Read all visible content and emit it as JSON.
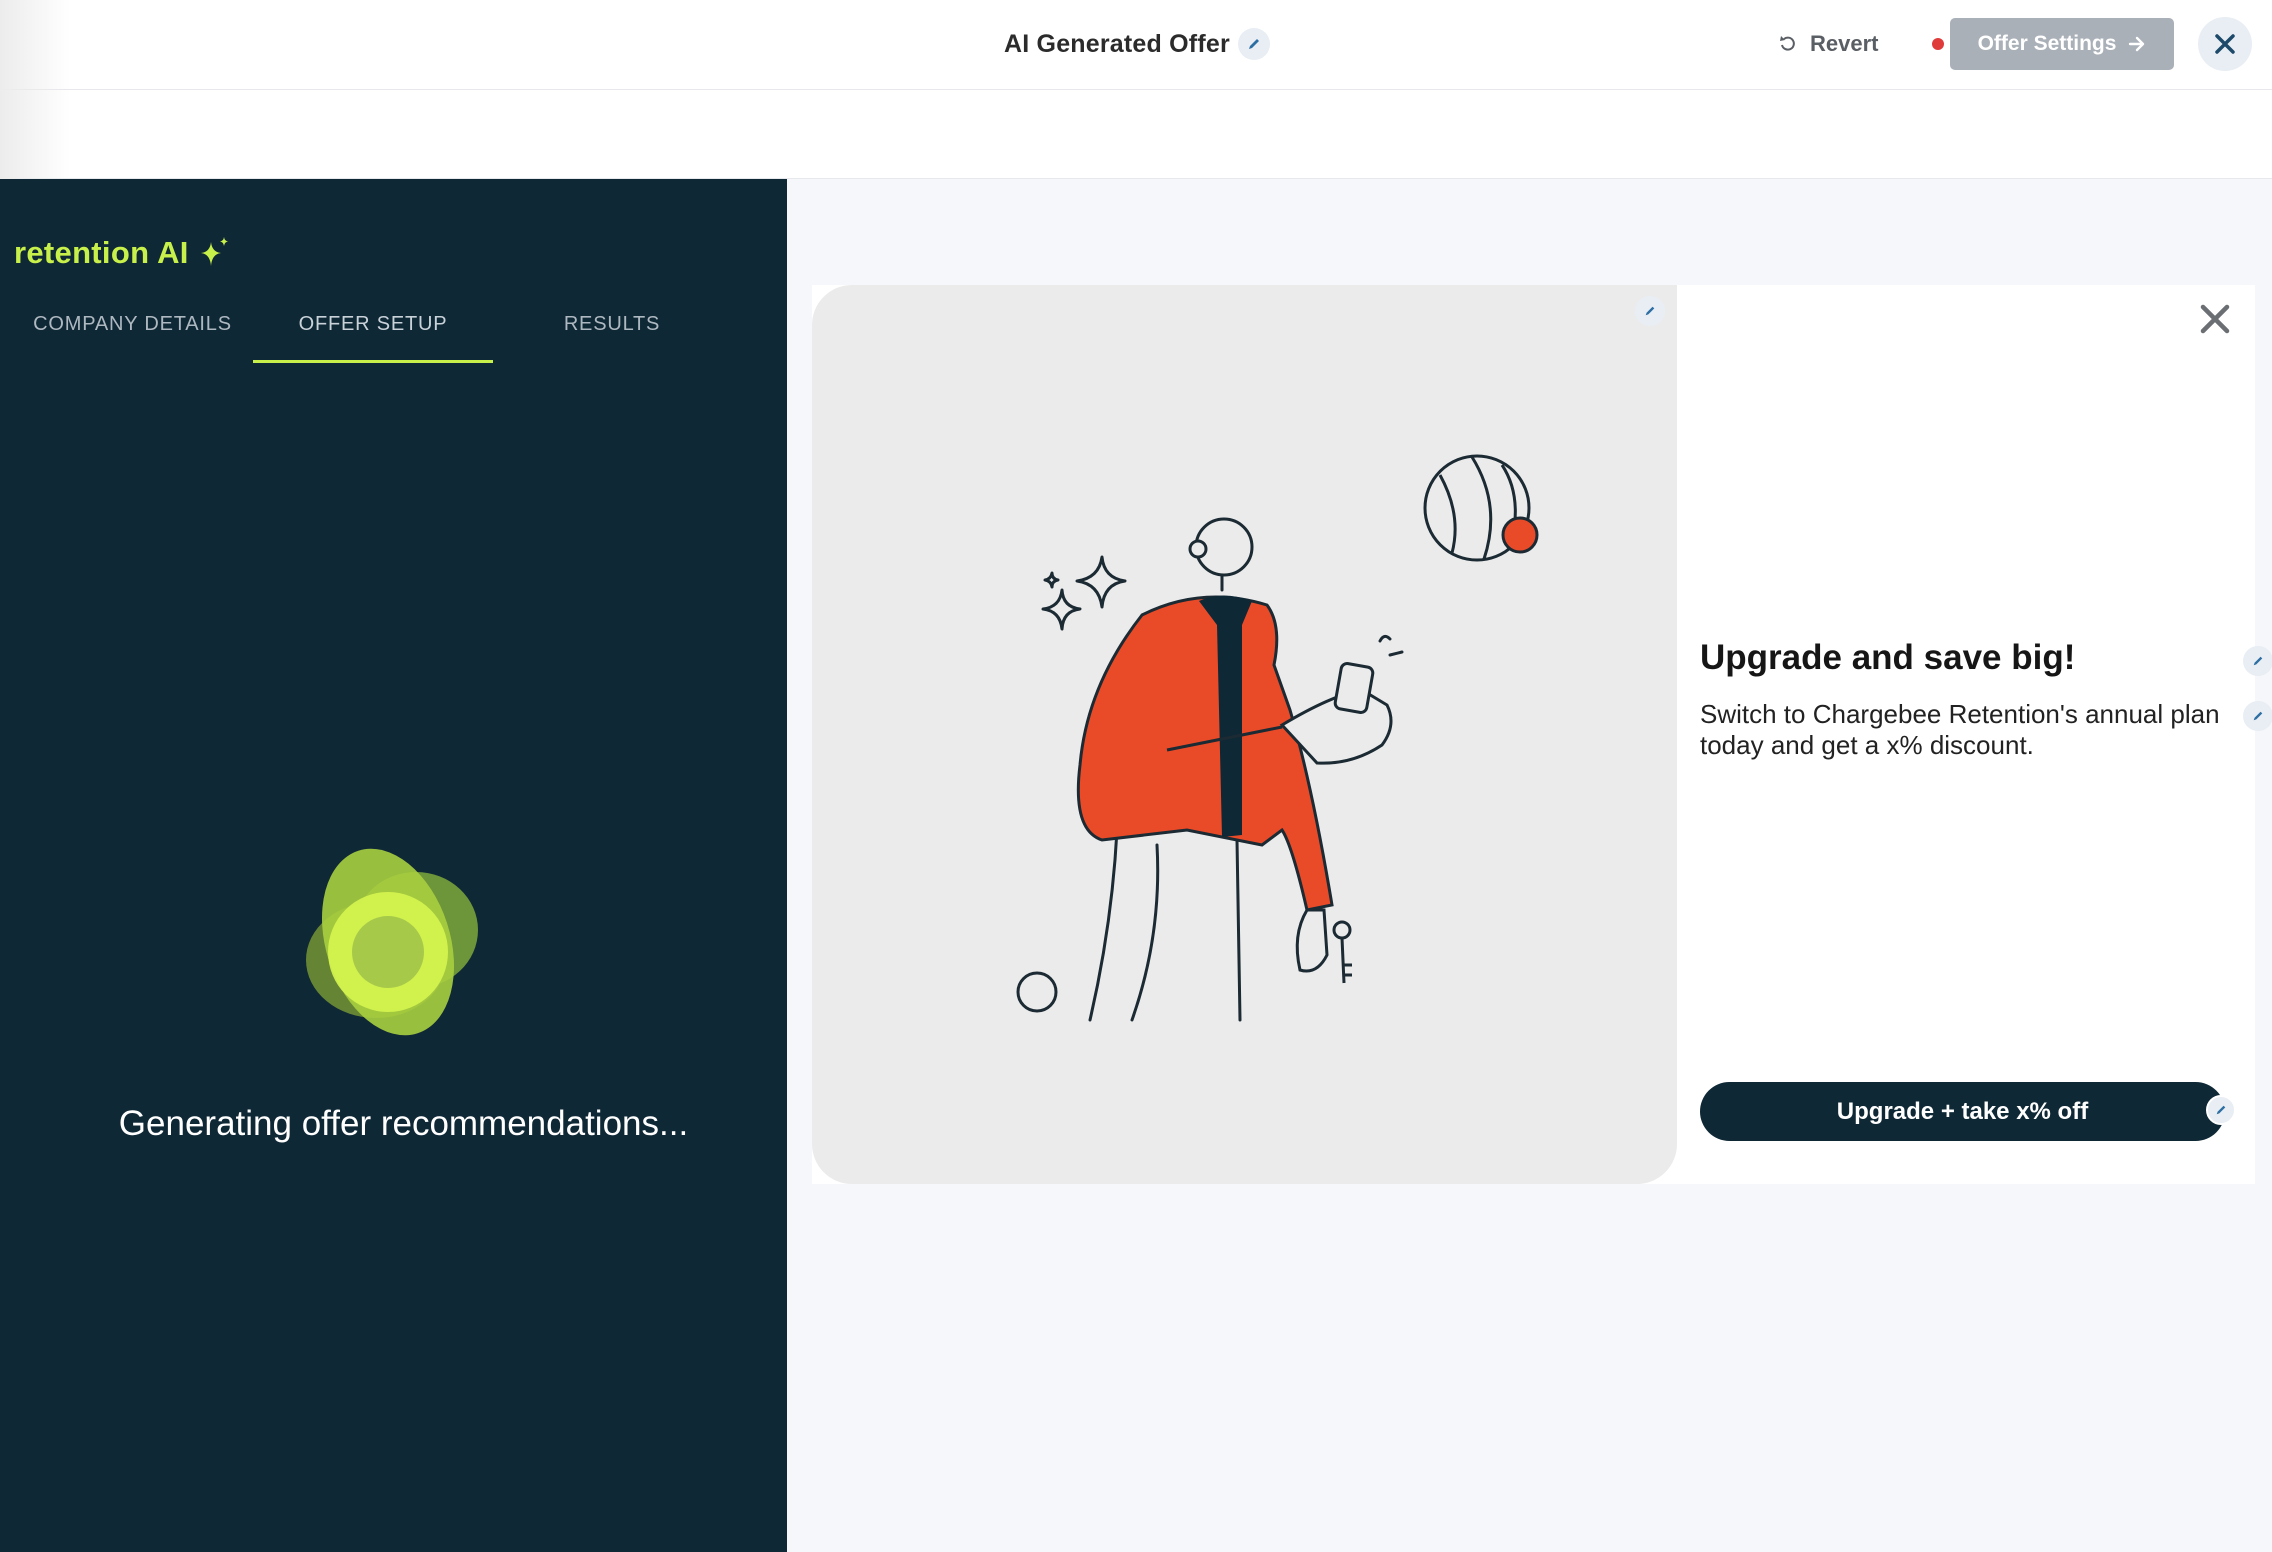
{
  "header": {
    "title": "AI Generated Offer",
    "revert_label": "Revert",
    "offer_settings_label": "Offer Settings"
  },
  "sidebar": {
    "brand": "retention AI",
    "tabs": [
      {
        "label": "COMPANY DETAILS",
        "active": false
      },
      {
        "label": "OFFER SETUP",
        "active": true
      },
      {
        "label": "RESULTS",
        "active": false
      }
    ],
    "status_text": "Generating offer recommendations..."
  },
  "offer": {
    "headline": "Upgrade and save big!",
    "description": "Switch to Chargebee Retention's annual plan today and get a x% discount.",
    "cta_label": "Upgrade + take x% off"
  },
  "colors": {
    "navy": "#0f2836",
    "lime": "#c8f04a",
    "orange": "#e94b29",
    "dirty_dot": "#e03b3b"
  },
  "icons": [
    "edit-icon",
    "revert-icon",
    "arrow-right-icon",
    "close-icon",
    "sparkle-icon",
    "loader-blob-icon"
  ]
}
